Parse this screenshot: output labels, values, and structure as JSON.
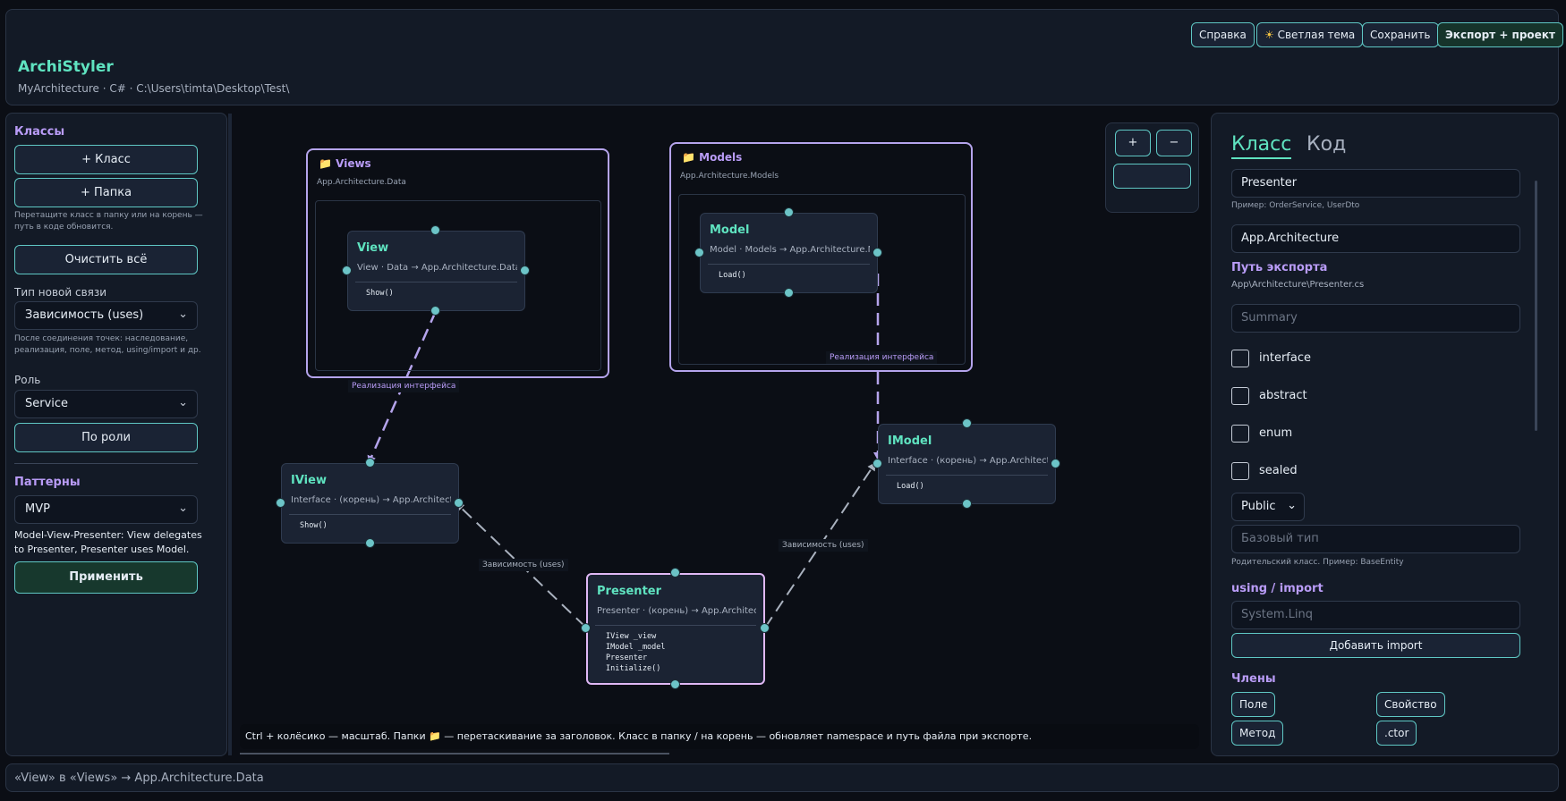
{
  "header": {
    "title": "ArchiStyler",
    "subtitle": "MyArchitecture · C# · C:\\Users\\timta\\Desktop\\Test\\",
    "buttons": {
      "help": "Справка",
      "theme": "Светлая тема",
      "save": "Сохранить",
      "export": "Экспорт + проект"
    },
    "theme_icon": "☀"
  },
  "left": {
    "classes_title": "Классы",
    "add_class": "+ Класс",
    "add_folder": "+ Папка",
    "drag_hint": "Перетащите класс в папку или на корень — путь в коде обновится.",
    "clear_all": "Очистить всё",
    "link_type_label": "Тип новой связи",
    "link_type_value": "Зависимость (uses)",
    "link_hint": "После соединения точек: наследование, реализация, поле, метод, using/import и др.",
    "role_label": "Роль",
    "role_value": "Service",
    "by_role": "По роли",
    "patterns_title": "Паттерны",
    "pattern_value": "MVP",
    "pattern_desc": "Model-View-Presenter: View delegates to Presenter, Presenter uses Model.",
    "apply": "Применить"
  },
  "canvas": {
    "folders": [
      {
        "name": "Views",
        "namespace": "App.Architecture.Data"
      },
      {
        "name": "Models",
        "namespace": "App.Architecture.Models"
      }
    ],
    "folder_icon": "folder-icon",
    "classes": {
      "view": {
        "name": "View",
        "meta": "View · Data → App.Architecture.Data",
        "members": "Show()"
      },
      "model": {
        "name": "Model",
        "meta": "Model · Models → App.Architecture.Models",
        "members": "Load()"
      },
      "iview": {
        "name": "IView",
        "meta": "Interface · (корень) → App.Architecture",
        "members": "Show()"
      },
      "imodel": {
        "name": "IModel",
        "meta": "Interface · (корень) → App.Architecture",
        "members": "Load()"
      },
      "presenter": {
        "name": "Presenter",
        "meta": "Presenter · (корень) → App.Architecture",
        "members": "IView _view\nIModel _model\nPresenter\nInitialize()"
      }
    },
    "edges": {
      "view_iview": "Реализация интерфейса",
      "model_imodel": "Реализация интерфейса",
      "presenter_iview": "Зависимость (uses)",
      "presenter_imodel": "Зависимость (uses)"
    },
    "zoom": {
      "plus": "+",
      "minus": "−",
      "value": ""
    },
    "hint": "Ctrl + колёсико — масштаб. Папки 📁 — перетаскивание за заголовок. Класс в папку / на корень — обновляет namespace и путь файла при экспорте."
  },
  "right": {
    "tabs": {
      "class": "Класс",
      "code": "Код"
    },
    "class_name": "Presenter",
    "class_name_hint": "Пример: OrderService, UserDto",
    "namespace": "App.Architecture",
    "export_path_title": "Путь экспорта",
    "export_path": "App\\Architecture\\Presenter.cs",
    "summary_placeholder": "Summary",
    "checkboxes": {
      "interface": "interface",
      "abstract": "abstract",
      "enum": "enum",
      "sealed": "sealed"
    },
    "access": "Public",
    "base_type_placeholder": "Базовый тип",
    "base_type_hint": "Родительский класс. Пример: BaseEntity",
    "using_title": "using / import",
    "using_placeholder": "System.Linq",
    "add_import": "Добавить import",
    "members_title": "Члены",
    "member_buttons": {
      "field": "Поле",
      "property": "Свойство",
      "method": "Метод",
      "ctor": ".ctor"
    }
  },
  "status": "«View» в «Views» → App.Architecture.Data",
  "colors": {
    "accent": "#5fe3c0",
    "purple": "#b99cf7",
    "border": "#5fc7c4",
    "background": "#0b0e15"
  }
}
